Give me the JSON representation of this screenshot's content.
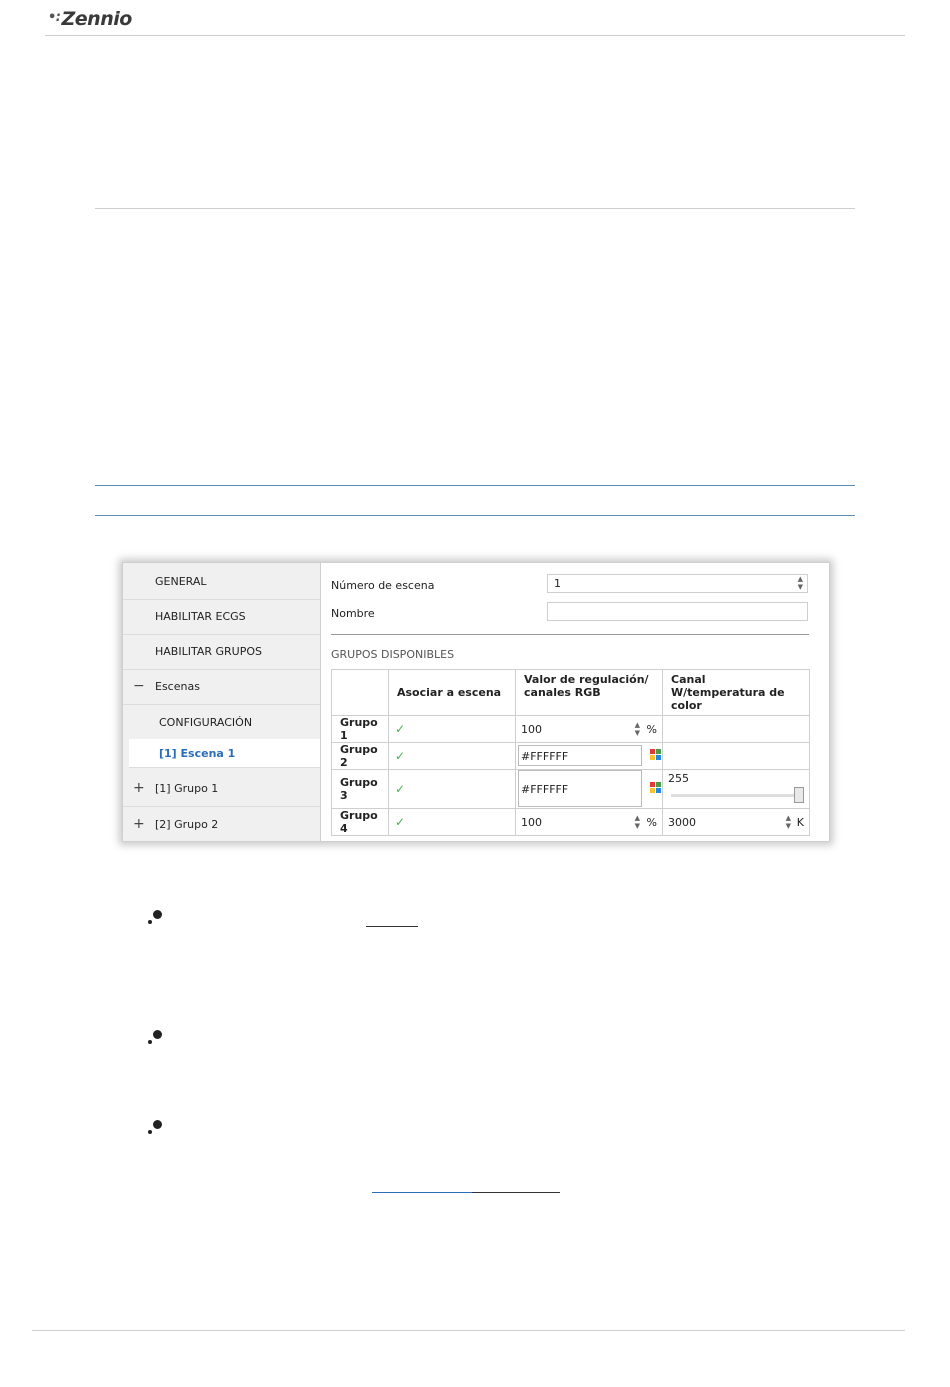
{
  "header": {
    "logo_text": "Zennio"
  },
  "ui": {
    "sidebar": {
      "items": [
        {
          "label": "GENERAL"
        },
        {
          "label": "HABILITAR ECGS"
        },
        {
          "label": "HABILITAR GRUPOS"
        },
        {
          "label": "Escenas",
          "toggle": "−"
        },
        {
          "label": "CONFIGURACIÓN"
        },
        {
          "label": "[1] Escena 1"
        },
        {
          "label": "[1] Grupo 1",
          "toggle": "+"
        },
        {
          "label": "[2] Grupo 2",
          "toggle": "+"
        }
      ]
    },
    "scene_number": {
      "label": "Número de escena",
      "value": "1"
    },
    "name": {
      "label": "Nombre",
      "value": ""
    },
    "section_title": "GRUPOS DISPONIBLES",
    "table": {
      "headers": [
        "Asociar a escena",
        "Valor de regulación/ canales RGB",
        "Canal W/temperatura de color"
      ],
      "rows": [
        {
          "name": "Grupo 1",
          "checked": true,
          "value": "100",
          "unit": "%",
          "w_value": "",
          "w_unit": ""
        },
        {
          "name": "Grupo 2",
          "checked": true,
          "value": "#FFFFFF",
          "unit": "",
          "w_value": "",
          "w_unit": ""
        },
        {
          "name": "Grupo 3",
          "checked": true,
          "value": "#FFFFFF",
          "unit": "",
          "w_value": "255",
          "w_unit": ""
        },
        {
          "name": "Grupo 4",
          "checked": true,
          "value": "100",
          "unit": "%",
          "w_value": "3000",
          "w_unit": "K"
        }
      ],
      "check_glyph": "✓"
    }
  },
  "colors": {
    "rule": "#bdbdbd",
    "accent_rule": "#5b8db8",
    "selected": "#2a6ebb",
    "check": "#4caf50"
  }
}
